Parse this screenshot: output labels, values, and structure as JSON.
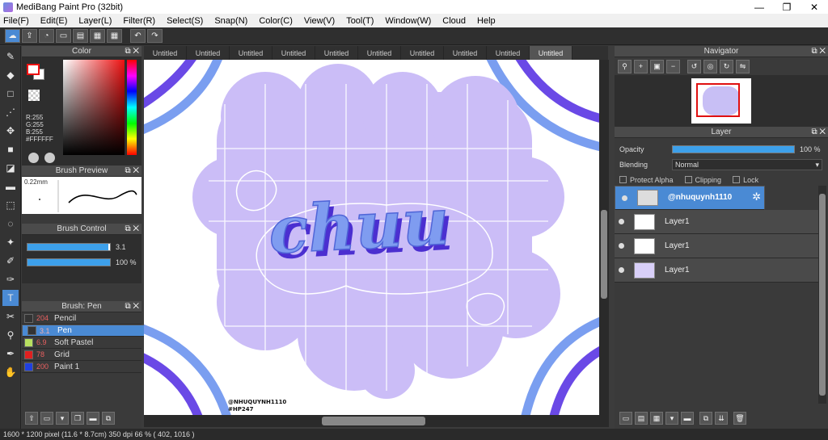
{
  "window": {
    "title": "MediBang Paint Pro (32bit)",
    "min": "—",
    "max": "❐",
    "close": "✕"
  },
  "menu": [
    "File(F)",
    "Edit(E)",
    "Layer(L)",
    "Filter(R)",
    "Select(S)",
    "Snap(N)",
    "Color(C)",
    "View(V)",
    "Tool(T)",
    "Window(W)",
    "Cloud",
    "Help"
  ],
  "color_panel": {
    "title": "Color",
    "r": "R:255",
    "g": "G:255",
    "b": "B:255",
    "hex": "#FFFFFF"
  },
  "brush_preview": {
    "title": "Brush Preview",
    "size": "0.22mm"
  },
  "brush_control": {
    "title": "Brush Control",
    "size_value": "3.1",
    "size_fraction": 0.98,
    "opacity_value": "100 %",
    "opacity_fraction": 1.0
  },
  "brush_list": {
    "title": "Brush: Pen",
    "items": [
      {
        "size": "204",
        "name": "Pencil",
        "color": "#333333"
      },
      {
        "size": "3.1",
        "name": "Pen",
        "color": "#333333"
      },
      {
        "size": "6.9",
        "name": "Soft Pastel",
        "color": "#b8e060"
      },
      {
        "size": "78",
        "name": "Grid",
        "color": "#e02020"
      },
      {
        "size": "200",
        "name": "Paint 1",
        "color": "#2040e0"
      }
    ]
  },
  "tabs": [
    "Untitled",
    "Untitled",
    "Untitled",
    "Untitled",
    "Untitled",
    "Untitled",
    "Untitled",
    "Untitled",
    "Untitled",
    "Untitled"
  ],
  "canvas": {
    "lettering": "chuu",
    "watermark_line1": "@NHUQUYNH1110",
    "watermark_line2": "#HP247"
  },
  "navigator": {
    "title": "Navigator"
  },
  "layer_panel": {
    "title": "Layer",
    "opacity_label": "Opacity",
    "opacity_value": "100 %",
    "blending_label": "Blending",
    "blending_value": "Normal",
    "protect_alpha": "Protect Alpha",
    "clipping": "Clipping",
    "lock": "Lock",
    "layers": [
      {
        "name": "@nhuquynh1110"
      },
      {
        "name": "Layer1"
      },
      {
        "name": "Layer1"
      },
      {
        "name": "Layer1"
      }
    ]
  },
  "status": "1600 * 1200 pixel   (11.6 * 8.7cm)   350 dpi   66 %   ( 402, 1016 )",
  "colors": {
    "accent": "#4a8ad4",
    "lavender": "#cbbdf7",
    "letter": "#6c7fe0",
    "stripe_dark": "#6a49e6",
    "stripe_light": "#7a9ef0"
  }
}
